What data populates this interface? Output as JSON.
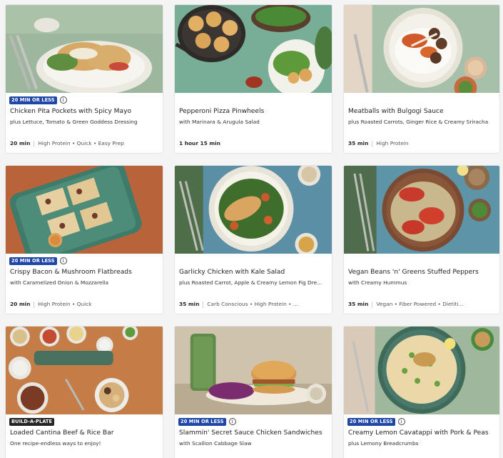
{
  "recipes": [
    {
      "badge": "20 MIN OR LESS",
      "title": "Chicken Pita Pockets with Spicy Mayo",
      "subtitle": "plus Lettuce, Tomato & Green Goddess Dressing",
      "time": "20 min",
      "tags": "High Protein • Quick • Easy Prep"
    },
    {
      "badge": "",
      "title": "Pepperoni Pizza Pinwheels",
      "subtitle": "with Marinara & Arugula Salad",
      "time": "1 hour 15 min",
      "tags": ""
    },
    {
      "badge": "",
      "title": "Meatballs with Bulgogi Sauce",
      "subtitle": "plus Roasted Carrots, Ginger Rice & Creamy Sriracha",
      "time": "35 min",
      "tags": "High Protein"
    },
    {
      "badge": "20 MIN OR LESS",
      "title": "Crispy Bacon & Mushroom Flatbreads",
      "subtitle": "with Caramelized Onion & Mozzarella",
      "time": "20 min",
      "tags": "High Protein • Quick"
    },
    {
      "badge": "",
      "title": "Garlicky Chicken with Kale Salad",
      "subtitle": "plus Roasted Carrot, Apple & Creamy Lemon Fig Dre...",
      "time": "35 min",
      "tags": "Carb Conscious • High Protein • ..."
    },
    {
      "badge": "",
      "title": "Vegan Beans 'n' Greens Stuffed Peppers",
      "subtitle": "with Creamy Hummus",
      "time": "35 min",
      "tags": "Vegan • Fiber Powered • Dietiti..."
    },
    {
      "badge": "BUILD-A-PLATE",
      "title": "Loaded Cantina Beef & Rice Bar",
      "subtitle": "One recipe-endless ways to enjoy!",
      "time": "",
      "tags": ""
    },
    {
      "badge": "20 MIN OR LESS",
      "title": "Slammin' Secret Sauce Chicken Sandwiches",
      "subtitle": "with Scallion Cabbage Slaw",
      "time": "",
      "tags": ""
    },
    {
      "badge": "20 MIN OR LESS",
      "title": "Creamy Lemon Cavatappi with Pork & Peas",
      "subtitle": "plus Lemony Breadcrumbs",
      "time": "",
      "tags": ""
    }
  ],
  "colors": {
    "badge_blue": "#1f47a8",
    "badge_dark": "#242424",
    "card_bg": "#ffffff",
    "page_bg": "#f4f4f4"
  },
  "icons": {
    "info": "info-icon"
  }
}
